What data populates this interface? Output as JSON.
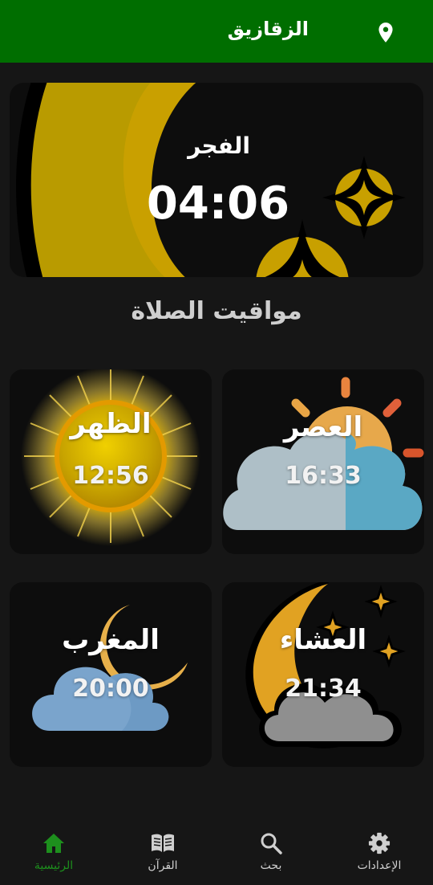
{
  "header": {
    "city": "الزقازيق",
    "location_icon": "location-pin-icon",
    "bar_color": "#006e00"
  },
  "next_prayer": {
    "name": "الفجر",
    "time": "04:06"
  },
  "section_title": "مواقيت الصلاة",
  "prayers": [
    {
      "name": "الظهر",
      "time": "12:56",
      "icon": "sun-icon"
    },
    {
      "name": "العصر",
      "time": "16:33",
      "icon": "sun-behind-cloud-icon"
    },
    {
      "name": "المغرب",
      "time": "20:00",
      "icon": "moon-behind-cloud-icon"
    },
    {
      "name": "العشاء",
      "time": "21:34",
      "icon": "crescent-stars-icon"
    }
  ],
  "nav": [
    {
      "label": "الرئيسية",
      "icon": "home-icon",
      "active": true
    },
    {
      "label": "القرآن",
      "icon": "book-icon",
      "active": false
    },
    {
      "label": "بحث",
      "icon": "search-icon",
      "active": false
    },
    {
      "label": "الإعدادات",
      "icon": "gear-icon",
      "active": false
    }
  ],
  "colors": {
    "active": "#1d8f1d",
    "background": "#161616",
    "card": "#0d0d0d"
  }
}
